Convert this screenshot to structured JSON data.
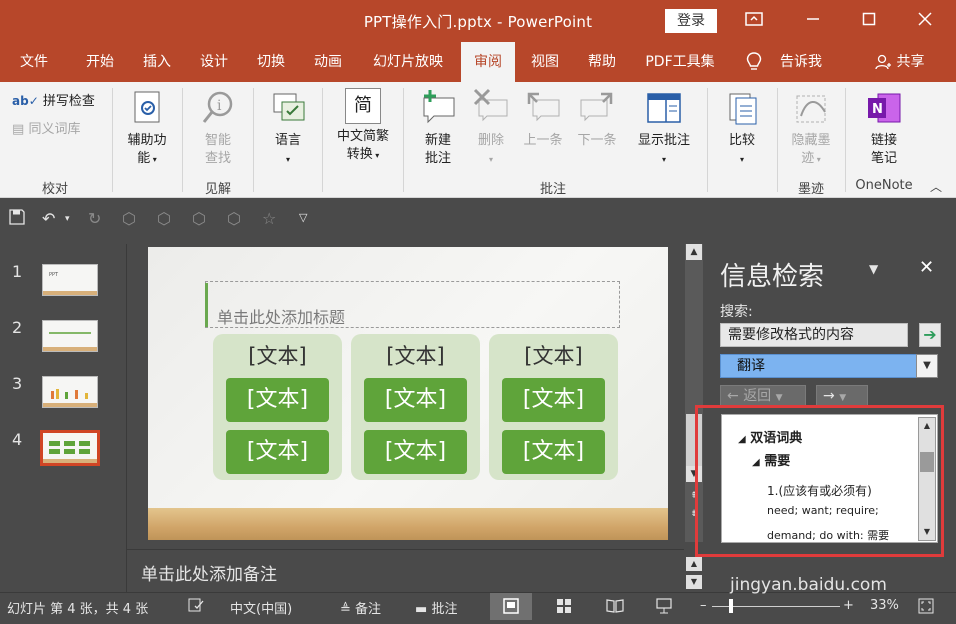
{
  "window": {
    "title": "PPT操作入门.pptx - PowerPoint",
    "login_button": "登录"
  },
  "menu": {
    "tabs": [
      "文件",
      "开始",
      "插入",
      "设计",
      "切换",
      "动画",
      "幻灯片放映",
      "审阅",
      "视图",
      "帮助",
      "PDF工具集"
    ],
    "active_tab": "审阅",
    "tell_me": "告诉我",
    "share": "共享"
  },
  "ribbon": {
    "proofing": {
      "spell_check": "拼写检查",
      "thesaurus": "同义词库",
      "group_label": "校对"
    },
    "accessibility": {
      "label_line1": "辅助功",
      "label_line2": "能"
    },
    "insights": {
      "label_line1": "智能",
      "label_line2": "查找",
      "group_label": "见解"
    },
    "language": {
      "label": "语言"
    },
    "chinese_conversion": {
      "icon_text": "简",
      "label_line1": "中文简繁",
      "label_line2": "转换"
    },
    "comments": {
      "new_line1": "新建",
      "new_line2": "批注",
      "delete": "删除",
      "previous": "上一条",
      "next": "下一条",
      "show": "显示批注",
      "group_label": "批注"
    },
    "compare": {
      "label": "比较"
    },
    "ink": {
      "label_line1": "隐藏墨",
      "label_line2": "迹",
      "group_label": "墨迹"
    },
    "onenote": {
      "label_line1": "链接",
      "label_line2": "笔记",
      "group_label": "OneNote"
    }
  },
  "thumbnails": {
    "numbers": [
      "1",
      "2",
      "3",
      "4"
    ],
    "selected": "4"
  },
  "slide": {
    "title_placeholder": "单击此处添加标题",
    "columns": [
      {
        "head": "[文本]",
        "box1": "[文本]",
        "box2": "[文本]"
      },
      {
        "head": "[文本]",
        "box1": "[文本]",
        "box2": "[文本]"
      },
      {
        "head": "[文本]",
        "box1": "[文本]",
        "box2": "[文本]"
      }
    ]
  },
  "notes": {
    "placeholder": "单击此处添加备注"
  },
  "research_pane": {
    "title": "信息检索",
    "search_label": "搜索:",
    "search_value": "需要修改格式的内容",
    "service": "翻译",
    "back": "返回",
    "results": {
      "section": "双语词典",
      "entry": "需要",
      "sense": "1.(应该有或必须有)",
      "line1": "need; want; require;",
      "line2": "demand; do with: 需要"
    }
  },
  "status": {
    "slide_info": "幻灯片 第 4 张，共 4 张",
    "language": "中文(中国)",
    "notes": "备注",
    "comments": "批注",
    "zoom": "33%"
  },
  "watermark": {
    "text": "jingyan.baidu.com"
  },
  "colors": {
    "title_bar": "#b7472a",
    "ribbon_bg": "#f3f3f3",
    "workspace_bg": "#4a4a4a",
    "slide_green": "#5fa43a",
    "slide_light_green": "#d6e4c9",
    "highlight_red": "#e03b3b",
    "selected_blue": "#7cb3f0"
  }
}
